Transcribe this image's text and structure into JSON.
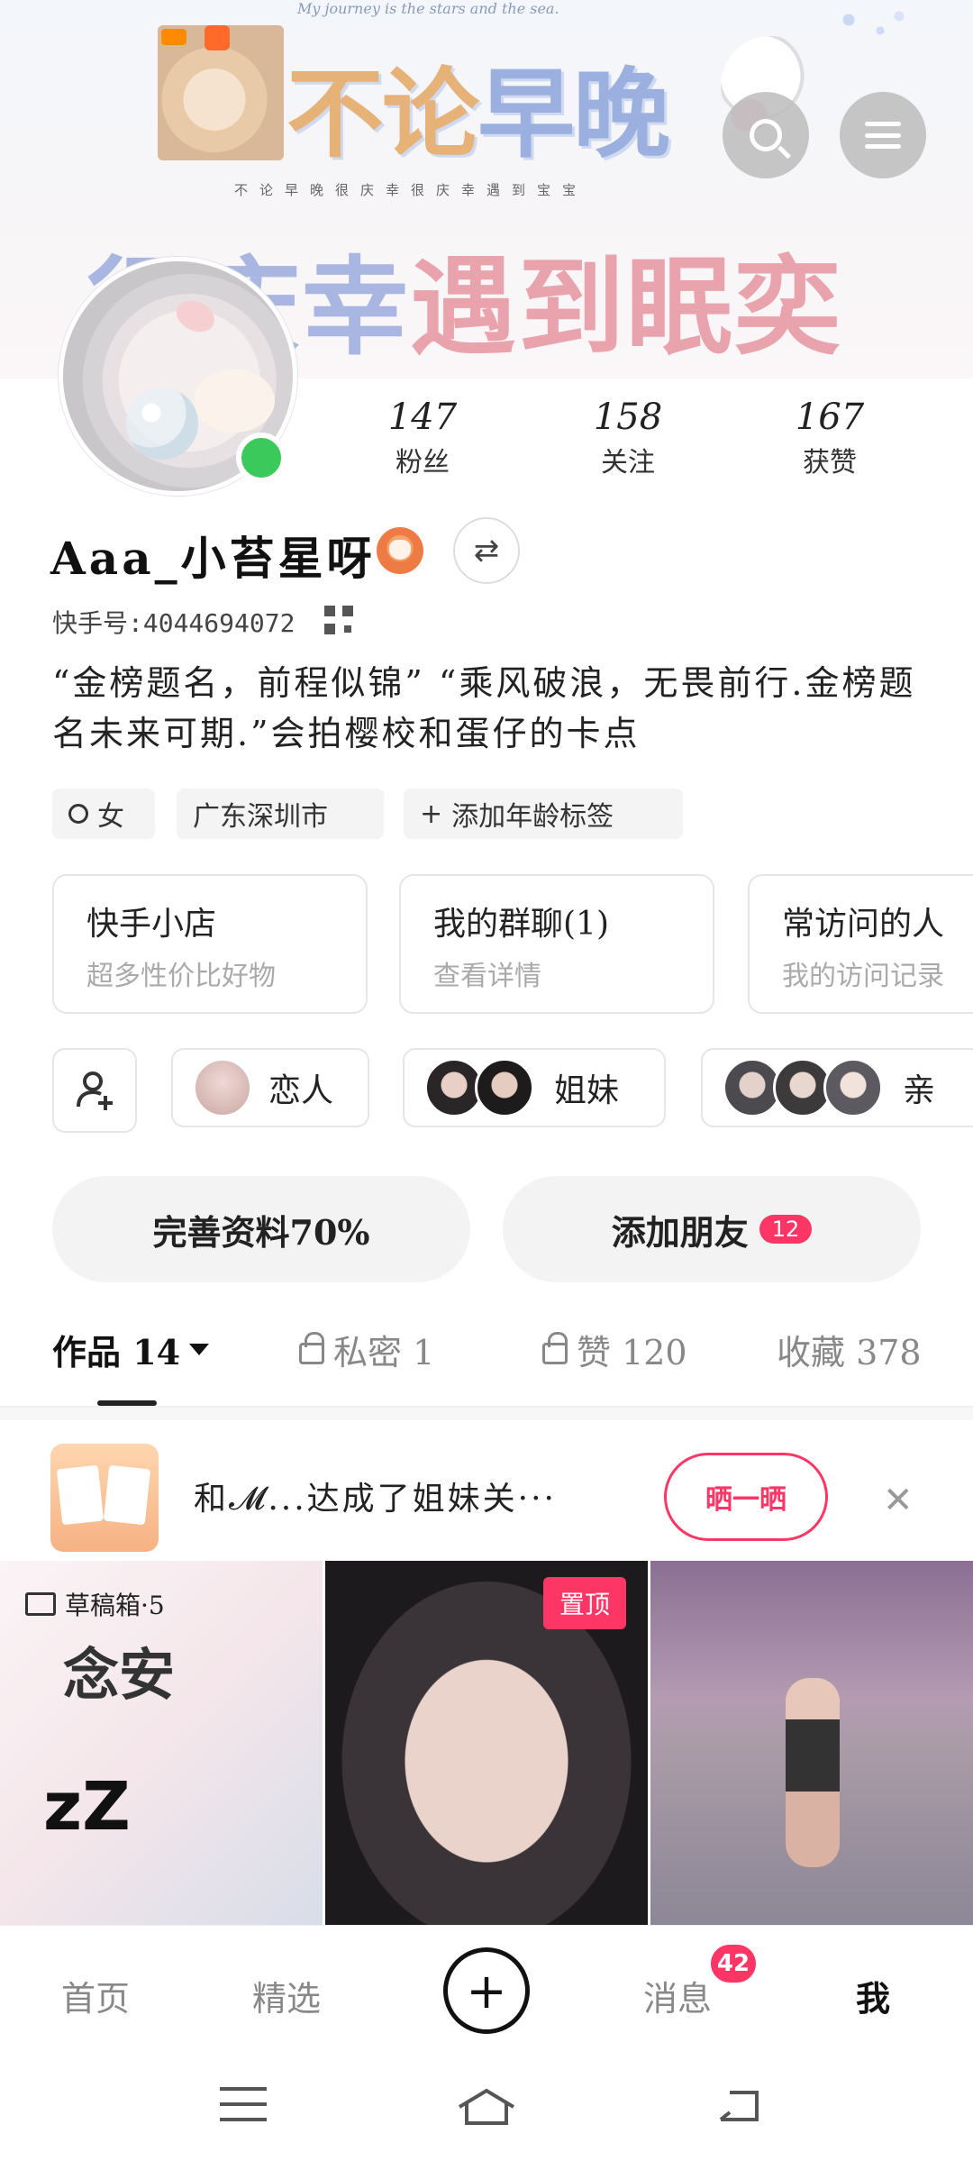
{
  "banner": {
    "top_text": "My journey is the stars and the sea.",
    "title_a": "不论",
    "title_b": "早晚",
    "subtitle": "不论早晚很庆幸很庆幸遇到宝宝",
    "big_a": "很庆幸",
    "big_b": "遇到眠奕"
  },
  "stats": [
    {
      "num": "147",
      "label": "粉丝"
    },
    {
      "num": "158",
      "label": "关注"
    },
    {
      "num": "167",
      "label": "获赞"
    }
  ],
  "profile": {
    "name": "Aaa_小苔星呀",
    "kuaishou_id": "快手号:4044694072",
    "bio": "“金榜题名，前程似锦” “乘风破浪，无畏前行.金榜题名未来可期.”会拍樱校和蛋仔的卡点"
  },
  "tags": [
    "女",
    "广东深圳市",
    "添加年龄标签"
  ],
  "cards": [
    {
      "title": "快手小店",
      "sub": "超多性价比好物"
    },
    {
      "title": "我的群聊(1)",
      "sub": "查看详情"
    },
    {
      "title": "常访问的人",
      "sub": "我的访问记录"
    }
  ],
  "relations": [
    "恋人",
    "姐妹",
    "亲"
  ],
  "actions": {
    "complete": "完善资料70%",
    "add_friend": "添加朋友",
    "add_friend_badge": "12"
  },
  "tabs": {
    "works": "作品 14",
    "private": "私密 1",
    "likes": "赞 120",
    "favorites": "收藏 378"
  },
  "promo": {
    "text": "和𝓜...达成了姐妹关···",
    "button": "晒一晒"
  },
  "grid": {
    "draft": "草稿箱·5",
    "g1_text": "念安",
    "zz": "zZ",
    "pinned": "置顶"
  },
  "nav": {
    "home": "首页",
    "featured": "精选",
    "messages": "消息",
    "messages_badge": "42",
    "me": "我"
  },
  "colors": {
    "accent": "#fe3666",
    "online": "#3ac95a"
  }
}
